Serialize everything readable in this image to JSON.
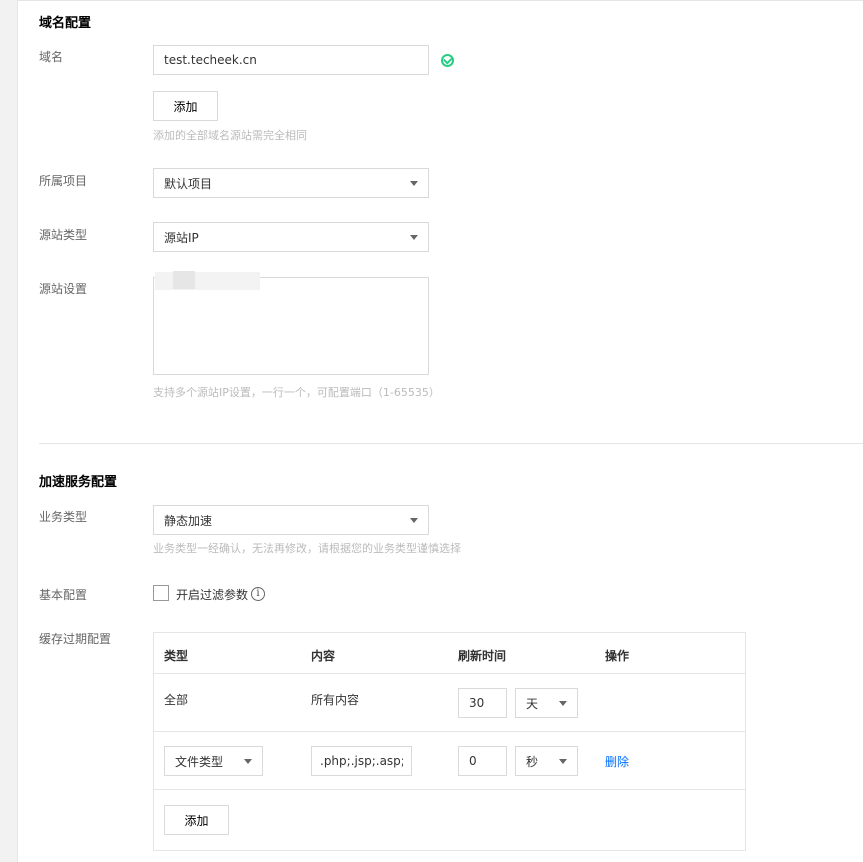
{
  "domain_section": {
    "title": "域名配置",
    "domain_label": "域名",
    "domain_value": "test.techeek.cn",
    "add_button": "添加",
    "add_hint": "添加的全部域名源站需完全相同",
    "project_label": "所属项目",
    "project_value": "默认项目",
    "origin_type_label": "源站类型",
    "origin_type_value": "源站IP",
    "origin_setting_label": "源站设置",
    "origin_hint": "支持多个源站IP设置，一行一个，可配置端口（1-65535）"
  },
  "accel_section": {
    "title": "加速服务配置",
    "biz_type_label": "业务类型",
    "biz_type_value": "静态加速",
    "biz_type_hint": "业务类型一经确认，无法再修改，请根据您的业务类型谨慎选择",
    "basic_label": "基本配置",
    "filter_param_label": "开启过滤参数",
    "filter_param_checked": false,
    "cache_label": "缓存过期配置",
    "cache_table": {
      "headers": [
        "类型",
        "内容",
        "刷新时间",
        "操作"
      ],
      "row1": {
        "type": "全部",
        "content": "所有内容",
        "time": "30",
        "unit": "天"
      },
      "row2": {
        "type": "文件类型",
        "content": ".php;.jsp;.asp;.a",
        "time": "0",
        "unit": "秒",
        "action": "删除"
      },
      "add_button": "添加"
    }
  },
  "colors": {
    "accent": "#006eff",
    "ok": "#29cc85"
  }
}
